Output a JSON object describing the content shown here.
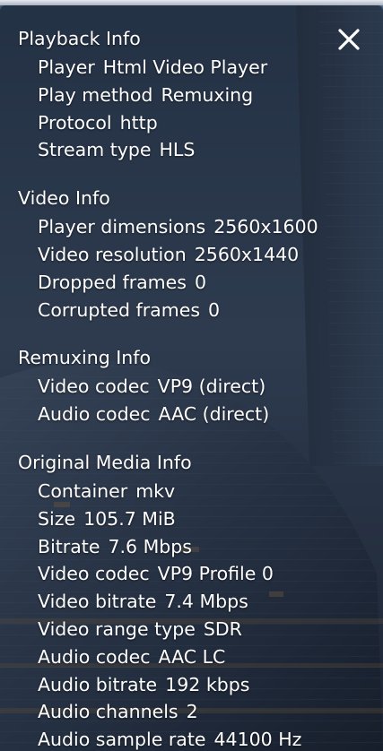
{
  "close_icon": "close-x-icon",
  "colors": {
    "text": "#ffffff",
    "overlay": "#141a26"
  },
  "sections": [
    {
      "title": "Playback Info",
      "rows": [
        {
          "label": "Player",
          "value": "Html Video Player"
        },
        {
          "label": "Play method",
          "value": "Remuxing"
        },
        {
          "label": "Protocol",
          "value": "http"
        },
        {
          "label": "Stream type",
          "value": "HLS"
        }
      ]
    },
    {
      "title": "Video Info",
      "rows": [
        {
          "label": "Player dimensions",
          "value": "2560x1600"
        },
        {
          "label": "Video resolution",
          "value": "2560x1440"
        },
        {
          "label": "Dropped frames",
          "value": "0"
        },
        {
          "label": "Corrupted frames",
          "value": "0"
        }
      ]
    },
    {
      "title": "Remuxing Info",
      "rows": [
        {
          "label": "Video codec",
          "value": "VP9 (direct)"
        },
        {
          "label": "Audio codec",
          "value": "AAC (direct)"
        }
      ]
    },
    {
      "title": "Original Media Info",
      "rows": [
        {
          "label": "Container",
          "value": "mkv"
        },
        {
          "label": "Size",
          "value": "105.7 MiB"
        },
        {
          "label": "Bitrate",
          "value": "7.6 Mbps"
        },
        {
          "label": "Video codec",
          "value": "VP9 Profile 0"
        },
        {
          "label": "Video bitrate",
          "value": "7.4 Mbps"
        },
        {
          "label": "Video range type",
          "value": "SDR"
        },
        {
          "label": "Audio codec",
          "value": "AAC LC"
        },
        {
          "label": "Audio bitrate",
          "value": "192 kbps"
        },
        {
          "label": "Audio channels",
          "value": "2"
        },
        {
          "label": "Audio sample rate",
          "value": "44100 Hz"
        }
      ]
    }
  ]
}
